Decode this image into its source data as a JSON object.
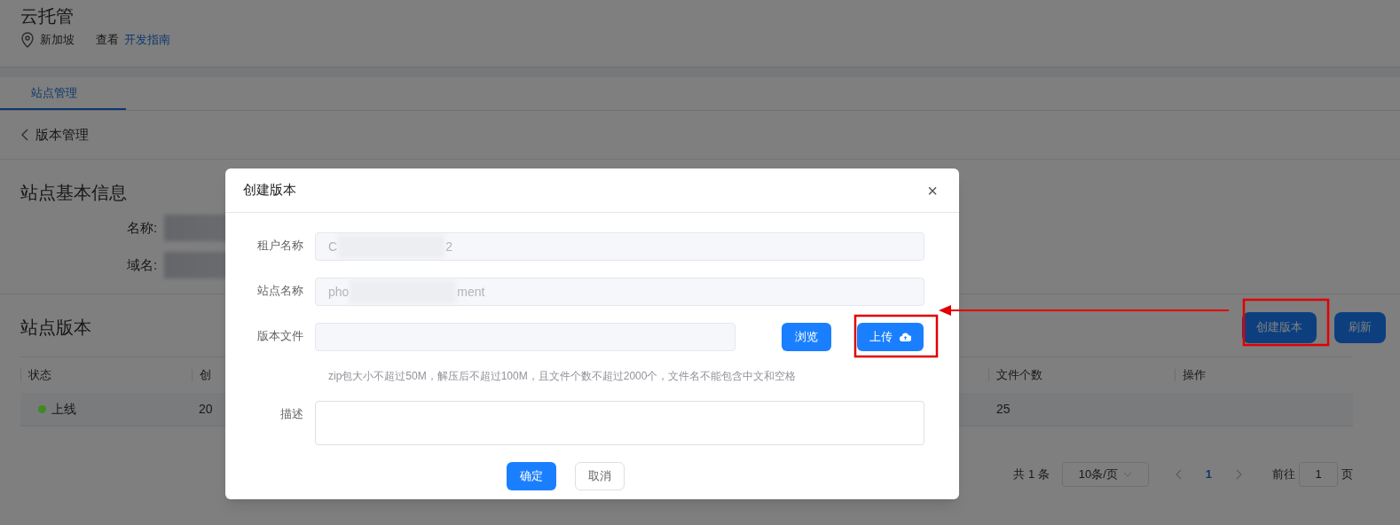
{
  "header": {
    "title": "云托管",
    "region": "新加坡",
    "guide_prefix": "查看",
    "guide_link": "开发指南"
  },
  "tabs": [
    {
      "label": "站点管理",
      "selected": true
    }
  ],
  "breadcrumb": {
    "back_label": "版本管理"
  },
  "site_info": {
    "title": "站点基本信息",
    "fields": [
      {
        "label": "名称:",
        "redacted": true
      },
      {
        "label": "域名:",
        "redacted": true
      }
    ]
  },
  "versions": {
    "title": "站点版本",
    "buttons": [
      {
        "label": "创建版本"
      },
      {
        "label": "刷新"
      }
    ],
    "table": {
      "columns": [
        "状态",
        "创",
        "文件个数",
        "操作"
      ],
      "rows": [
        {
          "status": "上线",
          "color": "#3f8a22",
          "created": "20",
          "file_count": "25"
        }
      ]
    }
  },
  "pagination": {
    "total": "共 1 条",
    "page_size": "10条/页",
    "pages": [
      {
        "label": "1",
        "selected": true
      }
    ],
    "goto_label": "前往",
    "goto_value": "1",
    "goto_suffix": "页"
  },
  "dialog": {
    "title": "创建版本",
    "close": "×",
    "fields": [
      {
        "kind": "text",
        "label": "租户名称",
        "visible_parts": [
          "C",
          "2"
        ]
      },
      {
        "kind": "text",
        "label": "站点名称",
        "visible_parts": [
          "pho",
          "ment"
        ]
      },
      {
        "kind": "file",
        "label": "版本文件",
        "browse": "浏览",
        "upload": "上传",
        "hint": "zip包大小不超过50M，解压后不超过100M，且文件个数不超过2000个，文件名不能包含中文和空格"
      },
      {
        "kind": "textarea",
        "label": "描述"
      }
    ],
    "confirm": "确定",
    "cancel": "取消"
  }
}
